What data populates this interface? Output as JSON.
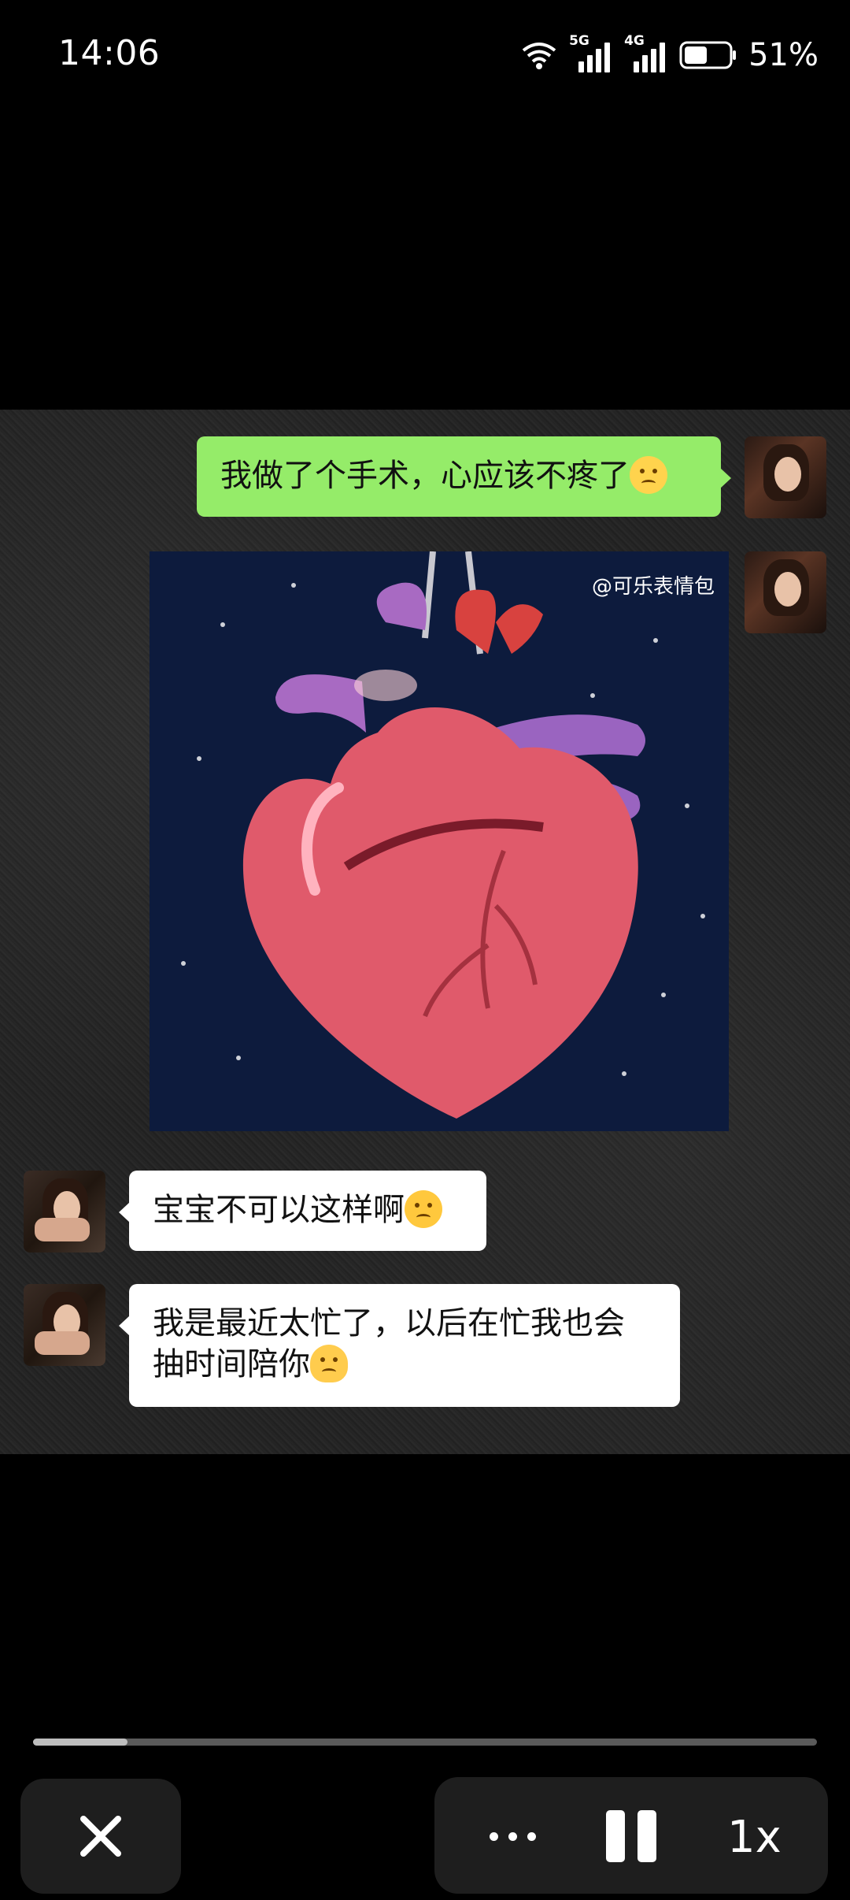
{
  "status_bar": {
    "time": "14:06",
    "network_1": "5G",
    "network_2": "4G",
    "battery_percent": "51%",
    "battery_level": 0.51
  },
  "messages": [
    {
      "side": "right",
      "type": "text",
      "text": "我做了个手术，心应该不疼了",
      "emoji": "sad-face-emoji"
    },
    {
      "side": "right",
      "type": "image",
      "image_desc": "cartoon heart held by forceps",
      "watermark": "@可乐表情包"
    },
    {
      "side": "left",
      "type": "text",
      "text": "宝宝不可以这样啊",
      "emoji": "crying-face-emoji"
    },
    {
      "side": "left",
      "type": "text",
      "text_line1": "我是最近太忙了，以后在忙我也会",
      "text_line2": "抽时间陪你",
      "emoji": "shrug-emoji"
    }
  ],
  "player": {
    "progress": 0.12,
    "close_icon": "close-icon",
    "more_icon": "more-icon",
    "pause_icon": "pause-icon",
    "speed_label": "1x"
  },
  "colors": {
    "sent_bubble": "#95ec69",
    "received_bubble": "#ffffff",
    "heart_bg": "#0d1b3d"
  }
}
